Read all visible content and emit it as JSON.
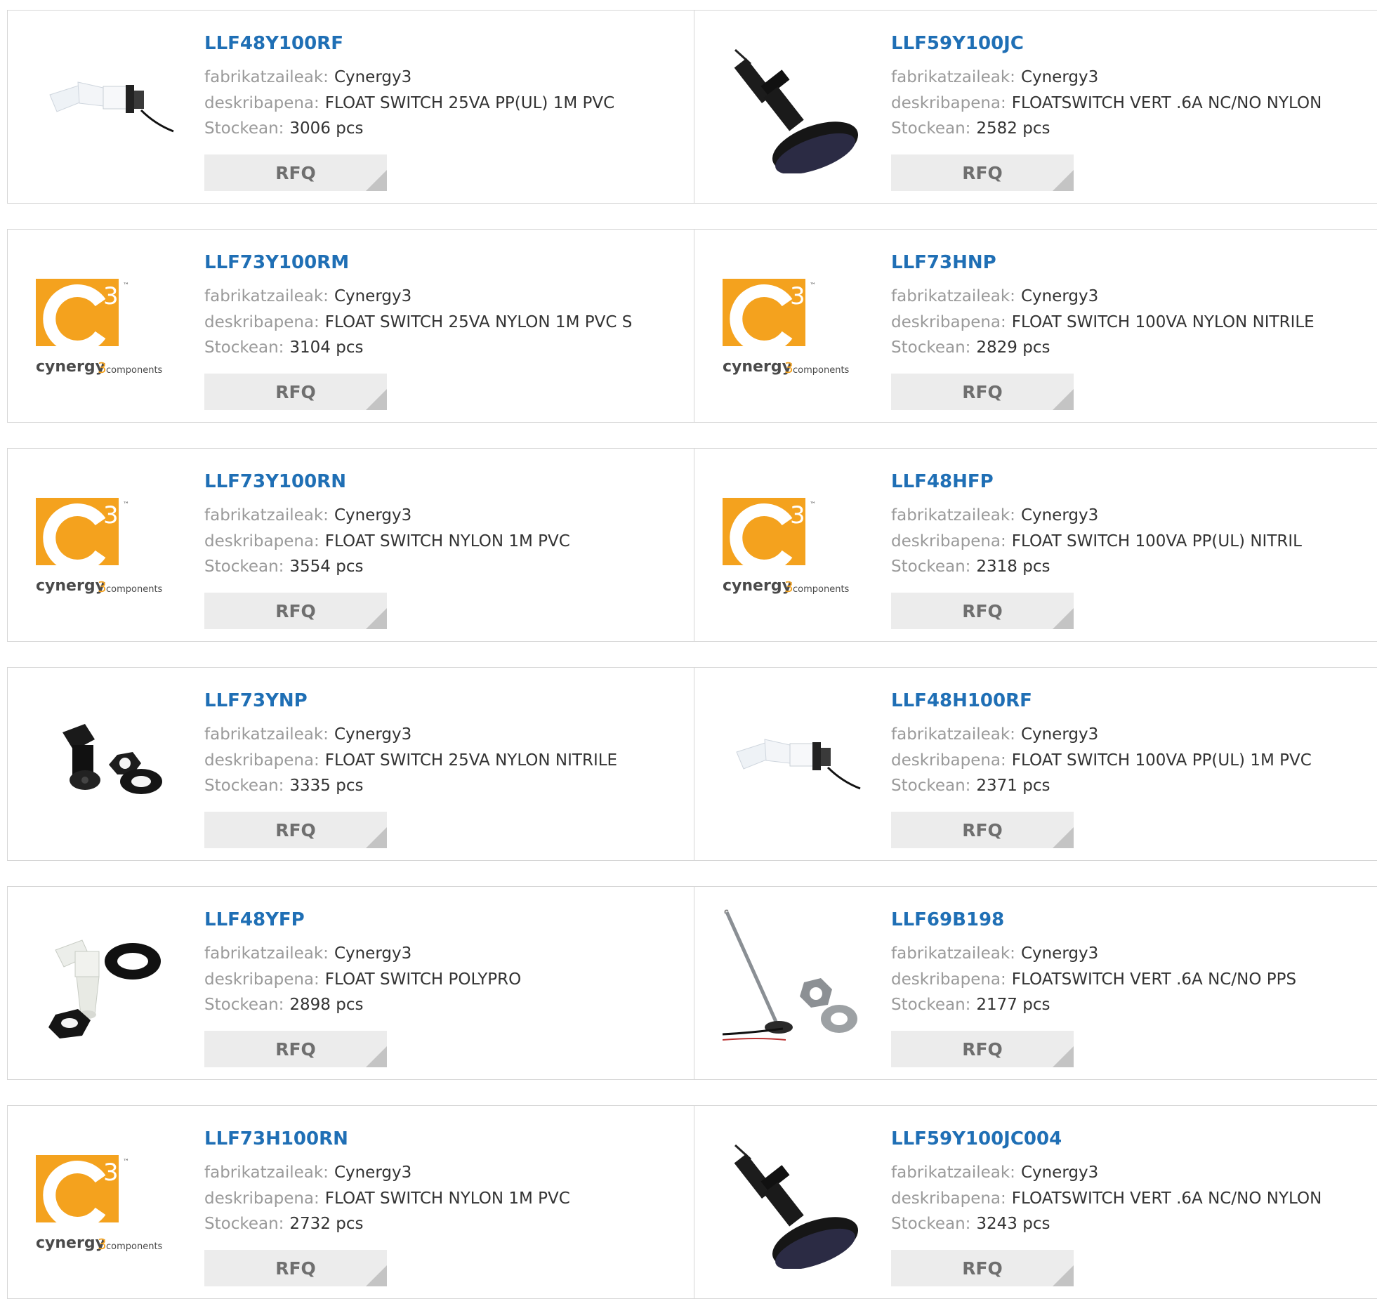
{
  "labels": {
    "manufacturer": "fabrikatzaileak:",
    "description": "deskribapena:",
    "stock": "Stockean:",
    "rfq": "RFQ"
  },
  "logo": {
    "brand": "cynergy",
    "sub": "components",
    "mark": "3",
    "tm": "™",
    "color": "#f4a21e"
  },
  "products": [
    {
      "part": "LLF48Y100RF",
      "manufacturer": "Cynergy3",
      "description": "FLOAT SWITCH 25VA PP(UL) 1M PVC",
      "stock": "3006 pcs",
      "image": "white-side-float"
    },
    {
      "part": "LLF59Y100JC",
      "manufacturer": "Cynergy3",
      "description": "FLOATSWITCH VERT .6A NC/NO NYLON",
      "stock": "2582 pcs",
      "image": "black-vertical-float"
    },
    {
      "part": "LLF73Y100RM",
      "manufacturer": "Cynergy3",
      "description": "FLOAT SWITCH 25VA NYLON 1M PVC S",
      "stock": "3104 pcs",
      "image": "cynergy3-logo"
    },
    {
      "part": "LLF73HNP",
      "manufacturer": "Cynergy3",
      "description": "FLOAT SWITCH 100VA NYLON NITRILE",
      "stock": "2829 pcs",
      "image": "cynergy3-logo"
    },
    {
      "part": "LLF73Y100RN",
      "manufacturer": "Cynergy3",
      "description": "FLOAT SWITCH NYLON 1M PVC",
      "stock": "3554 pcs",
      "image": "cynergy3-logo"
    },
    {
      "part": "LLF48HFP",
      "manufacturer": "Cynergy3",
      "description": "FLOAT SWITCH 100VA PP(UL) NITRIL",
      "stock": "2318 pcs",
      "image": "cynergy3-logo"
    },
    {
      "part": "LLF73YNP",
      "manufacturer": "Cynergy3",
      "description": "FLOAT SWITCH 25VA NYLON NITRILE",
      "stock": "3335 pcs",
      "image": "black-switch-kit"
    },
    {
      "part": "LLF48H100RF",
      "manufacturer": "Cynergy3",
      "description": "FLOAT SWITCH 100VA PP(UL) 1M PVC",
      "stock": "2371 pcs",
      "image": "white-side-float"
    },
    {
      "part": "LLF48YFP",
      "manufacturer": "Cynergy3",
      "description": "FLOAT SWITCH POLYPRO",
      "stock": "2898 pcs",
      "image": "white-switch-kit"
    },
    {
      "part": "LLF69B198",
      "manufacturer": "Cynergy3",
      "description": "FLOATSWITCH VERT .6A NC/NO PPS",
      "stock": "2177 pcs",
      "image": "rod-float-kit"
    },
    {
      "part": "LLF73H100RN",
      "manufacturer": "Cynergy3",
      "description": "FLOAT SWITCH NYLON 1M PVC",
      "stock": "2732 pcs",
      "image": "cynergy3-logo"
    },
    {
      "part": "LLF59Y100JC004",
      "manufacturer": "Cynergy3",
      "description": "FLOATSWITCH VERT .6A NC/NO NYLON",
      "stock": "3243 pcs",
      "image": "black-vertical-float"
    }
  ]
}
